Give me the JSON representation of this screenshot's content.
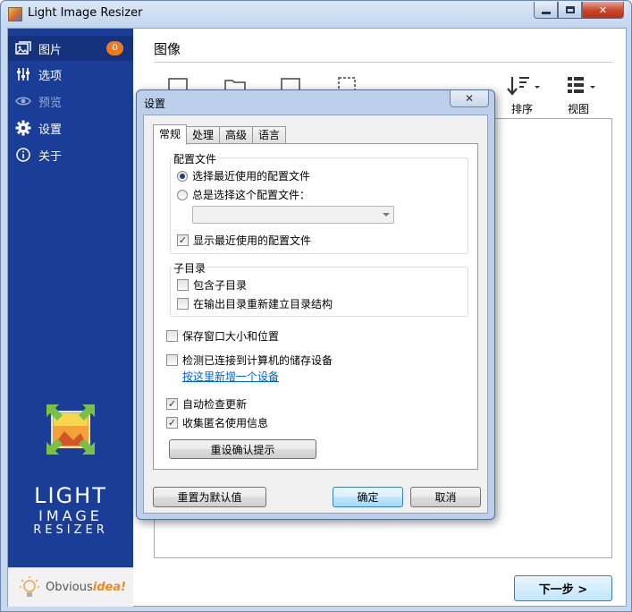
{
  "window": {
    "title": "Light Image Resizer"
  },
  "sidebar": {
    "items": [
      {
        "label": "图片",
        "icon": "pictures-icon",
        "badge": "0"
      },
      {
        "label": "选项",
        "icon": "sliders-icon"
      },
      {
        "label": "预览",
        "icon": "eye-icon"
      },
      {
        "label": "设置",
        "icon": "gear-icon"
      },
      {
        "label": "关于",
        "icon": "info-icon"
      }
    ],
    "logo": {
      "line1": "LIGHT",
      "line2": "IMAGE",
      "line3": "RESIZER"
    },
    "brand": {
      "prefix": "Obvious",
      "suffix": "idea!"
    }
  },
  "main": {
    "title": "图像",
    "toolbar": {
      "sort_label": "排序",
      "view_label": "视图"
    },
    "next_button": "下一步 >"
  },
  "dialog": {
    "title": "设置",
    "close_glyph": "✕",
    "tabs": [
      "常规",
      "处理",
      "高级",
      "语言"
    ],
    "profile_group": {
      "label": "配置文件",
      "radio_recent": "选择最近使用的配置文件",
      "radio_always": "总是选择这个配置文件：",
      "combo_value": "",
      "show_recent": "显示最近使用的配置文件"
    },
    "subdir_group": {
      "label": "子目录",
      "include_sub": "包含子目录",
      "rebuild_structure": "在输出目录重新建立目录结构"
    },
    "save_window": "保存窗口大小和位置",
    "detect_storage": "检测已连接到计算机的储存设备",
    "add_device_link": "按这里新增一个设备",
    "auto_update": "自动检查更新",
    "anon_usage": "收集匿名使用信息",
    "reset_confirm_button": "重设确认提示",
    "reset_defaults_button": "重置为默认值",
    "ok_button": "确定",
    "cancel_button": "取消"
  }
}
